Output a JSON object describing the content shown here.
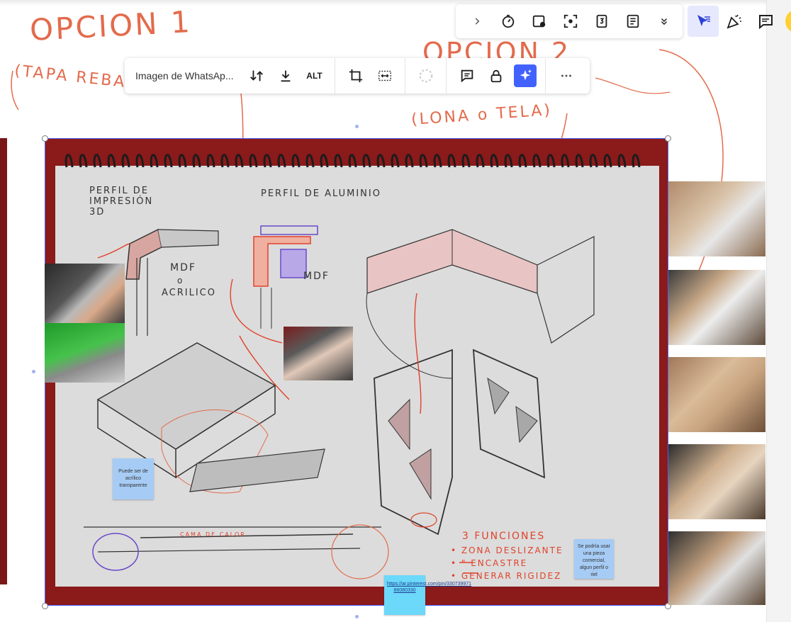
{
  "top_toolbar": {
    "items": [
      "chevron-right",
      "timer",
      "frame-plus",
      "focus",
      "countdown",
      "notes",
      "expand-more"
    ]
  },
  "right_tools": [
    "select-filter",
    "celebrate",
    "comment"
  ],
  "image_toolbar": {
    "file_name": "Imagen de WhatsAp...",
    "alt_label": "ALT"
  },
  "handwriting": {
    "option1_title": "OPCION 1",
    "option1_sub": "(TAPA REBATIB",
    "option2_title": "OPCION 2",
    "option2_sub": "(LONA o TELA)"
  },
  "sketch": {
    "profile_3d": "PERFIL DE IMPRESIÓN 3D",
    "profile_alu": "PERFIL DE ALUMINIO",
    "mdf1": "MDF",
    "mdf_or": "o",
    "acrilico": "ACRILICO",
    "mdf2": "MDF",
    "cama_calor": "CAMA DE CALOR",
    "funciones_title": "3 FUNCIONES",
    "funcion1": "• ZONA DESLIZANTE",
    "funcion2": "• \" ENCASTRE",
    "funcion3": "• GENERAR RIGIDEZ"
  },
  "stickies": {
    "acrilico": "Puede ser de acrílico transparente",
    "link": "https://ar.pinterest.com/pin/330739971 86080330",
    "pieza": "Se podría usar una pieza comercial, algun perfil o riel"
  },
  "colors": {
    "accent": "#4262ff",
    "handwriting": "#e36b4c",
    "sticky_blue": "#a6ccf5",
    "sticky_cyan": "#6cd8fa"
  }
}
